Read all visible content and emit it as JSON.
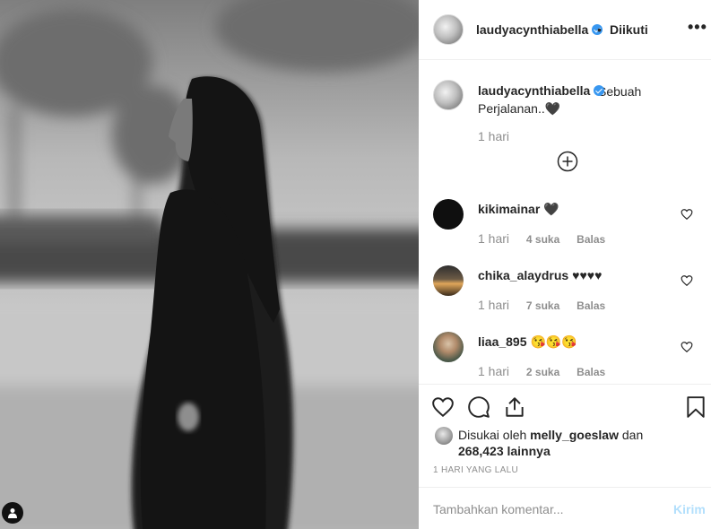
{
  "post_header": {
    "username": "laudyacynthiabella",
    "separator": "•",
    "follow_status": "Diikuti",
    "more_icon": "more-horizontal-icon",
    "more_label": "•••"
  },
  "caption": {
    "username": "laudyacynthiabella",
    "text": "Sebuah Perjalanan..🖤",
    "time": "1 hari"
  },
  "load_more_icon": "plus-circle-icon",
  "comments": [
    {
      "username": "kikimainar",
      "text": "🖤",
      "time": "1 hari",
      "likes": "4 suka",
      "reply": "Balas"
    },
    {
      "username": "chika_alaydrus",
      "text": "♥♥♥♥",
      "time": "1 hari",
      "likes": "7 suka",
      "reply": "Balas"
    },
    {
      "username": "liaa_895",
      "text": "😘😘😘",
      "time": "1 hari",
      "likes": "2 suka",
      "reply": "Balas"
    }
  ],
  "actions": {
    "like_icon": "heart-outline-icon",
    "comment_icon": "comment-icon",
    "share_icon": "share-icon",
    "save_icon": "bookmark-icon"
  },
  "likes": {
    "prefix": "Disukai oleh",
    "user": "melly_goeslaw",
    "conj": "dan",
    "count": "268,423 lainnya"
  },
  "posted_ago": "1 HARI YANG LALU",
  "add_comment": {
    "placeholder": "Tambahkan komentar...",
    "post_label": "Kirim"
  },
  "colors": {
    "verified": "#3897f0",
    "post_disabled": "#b2dffc",
    "muted": "#8e8e8e"
  }
}
